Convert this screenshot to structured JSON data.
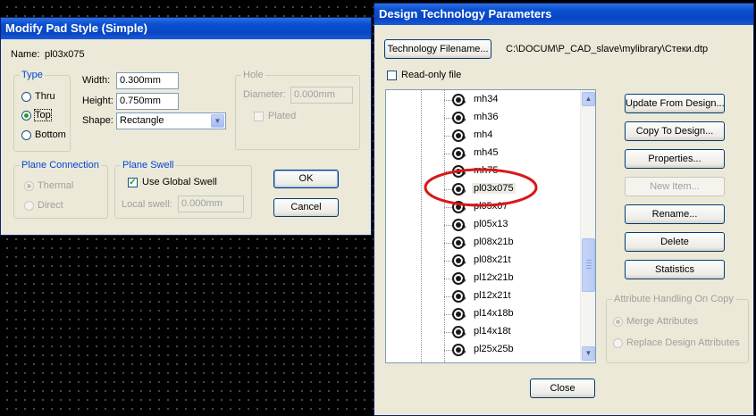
{
  "pad_style_dialog": {
    "title": "Modify Pad Style (Simple)",
    "name_label": "Name:",
    "name_value": "pl03x075",
    "type_group": {
      "title": "Type",
      "options": [
        "Thru",
        "Top",
        "Bottom"
      ],
      "selected": "Top"
    },
    "width_label": "Width:",
    "width_value": "0.300mm",
    "height_label": "Height:",
    "height_value": "0.750mm",
    "shape_label": "Shape:",
    "shape_value": "Rectangle",
    "hole_group": {
      "title": "Hole",
      "diameter_label": "Diameter:",
      "diameter_value": "0.000mm",
      "plated_label": "Plated"
    },
    "plane_connection_group": {
      "title": "Plane Connection",
      "options": [
        "Thermal",
        "Direct"
      ],
      "selected": "Thermal"
    },
    "plane_swell_group": {
      "title": "Plane Swell",
      "use_global_label": "Use Global Swell",
      "use_global_checked": true,
      "local_swell_label": "Local swell:",
      "local_swell_value": "0.000mm"
    },
    "ok_label": "OK",
    "cancel_label": "Cancel"
  },
  "dtp_dialog": {
    "title": "Design Technology Parameters",
    "tech_filename_button": "Technology Filename...",
    "file_path": "C:\\DOCUM\\P_CAD_slave\\mylibrary\\Стеки.dtp",
    "readonly_label": "Read-only file",
    "readonly_checked": false,
    "tree_items": [
      "mh34",
      "mh36",
      "mh4",
      "mh45",
      "mh75",
      "pl03x075",
      "pl05x07",
      "pl05x13",
      "pl08x21b",
      "pl08x21t",
      "pl12x21b",
      "pl12x21t",
      "pl14x18b",
      "pl14x18t",
      "pl25x25b"
    ],
    "selected_item": "pl03x075",
    "pad_icon_letter": "P",
    "buttons": {
      "update_from_design": "Update From Design...",
      "copy_to_design": "Copy To Design...",
      "properties": "Properties...",
      "new_item": "New Item...",
      "rename": "Rename...",
      "delete": "Delete",
      "statistics": "Statistics"
    },
    "attribute_group": {
      "title": "Attribute Handling On Copy",
      "options": [
        "Merge Attributes",
        "Replace Design Attributes"
      ],
      "selected": "Merge Attributes"
    },
    "close_label": "Close"
  },
  "annotation": {
    "color": "#d81818"
  }
}
